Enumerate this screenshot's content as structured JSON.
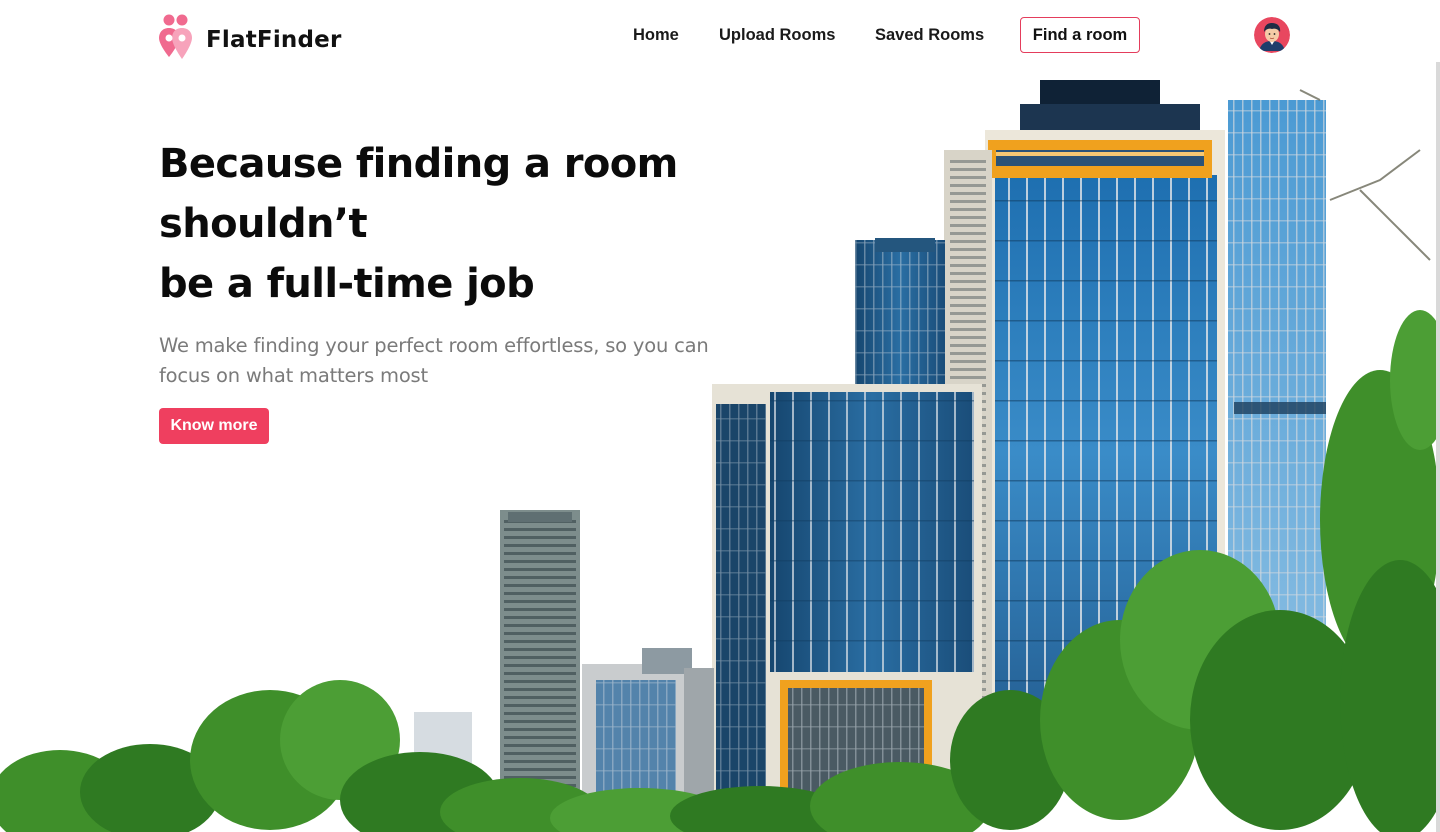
{
  "brand": {
    "name": "FlatFinder",
    "logo_icon": "location-pins-icon",
    "accent_color": "#ef3f5f",
    "logo_color": "#f06a8f"
  },
  "nav": {
    "home": "Home",
    "upload_rooms": "Upload Rooms",
    "saved_rooms": "Saved Rooms",
    "find_room": "Find a room",
    "avatar_icon": "user-avatar-icon"
  },
  "hero": {
    "title_line1": "Because finding a room shouldn’t",
    "title_line2": "be a full-time job",
    "subtitle": "We make finding your perfect room effortless, so you can focus on what matters most",
    "cta": "Know more"
  },
  "illustration": {
    "name": "city-skyline-illustration",
    "colors": {
      "glass": "#2f7fb8",
      "glass_dark": "#1d4f7c",
      "frame": "#e9e4d8",
      "accent": "#f0a11e",
      "tree": "#3f8f2a"
    }
  }
}
